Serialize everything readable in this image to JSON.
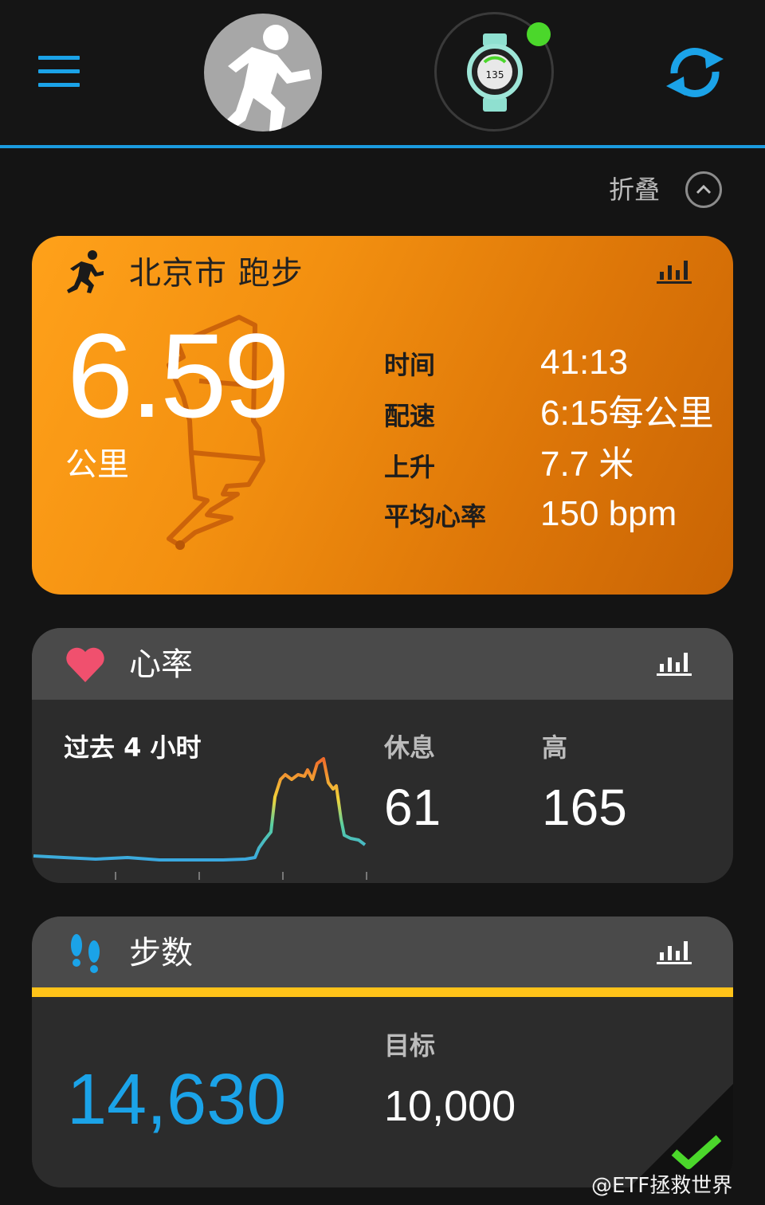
{
  "header": {
    "menu_icon": "hamburger-menu-icon",
    "avatar_icon": "activity-avatar-icon",
    "device_icon": "watch-device-icon",
    "device_watch_value": "135",
    "device_status_color": "#4bd72b",
    "sync_icon": "sync-icon",
    "accent_color": "#1b9be0"
  },
  "collapse": {
    "label": "折叠",
    "icon": "chevron-up-icon"
  },
  "activity": {
    "title": "北京市 跑步",
    "icon": "running-icon",
    "chart_icon": "bar-chart-icon",
    "distance": "6.59",
    "distance_unit": "公里",
    "stats": [
      {
        "label": "时间",
        "value": "41:13"
      },
      {
        "label": "配速",
        "value": "6:15每公里"
      },
      {
        "label": "上升",
        "value": "7.7 米"
      },
      {
        "label": "平均心率",
        "value": "150 bpm"
      }
    ]
  },
  "heart_rate": {
    "title": "心率",
    "icon": "heart-icon",
    "chart_icon": "bar-chart-icon",
    "period": "过去 4 小时",
    "rest_label": "休息",
    "rest_value": "61",
    "high_label": "高",
    "high_value": "165"
  },
  "steps": {
    "title": "步数",
    "icon": "footprints-icon",
    "chart_icon": "bar-chart-icon",
    "value": "14,630",
    "goal_label": "目标",
    "goal_value": "10,000",
    "goal_icon": "checkmark-icon"
  },
  "watermark": "@ETF拯救世界"
}
